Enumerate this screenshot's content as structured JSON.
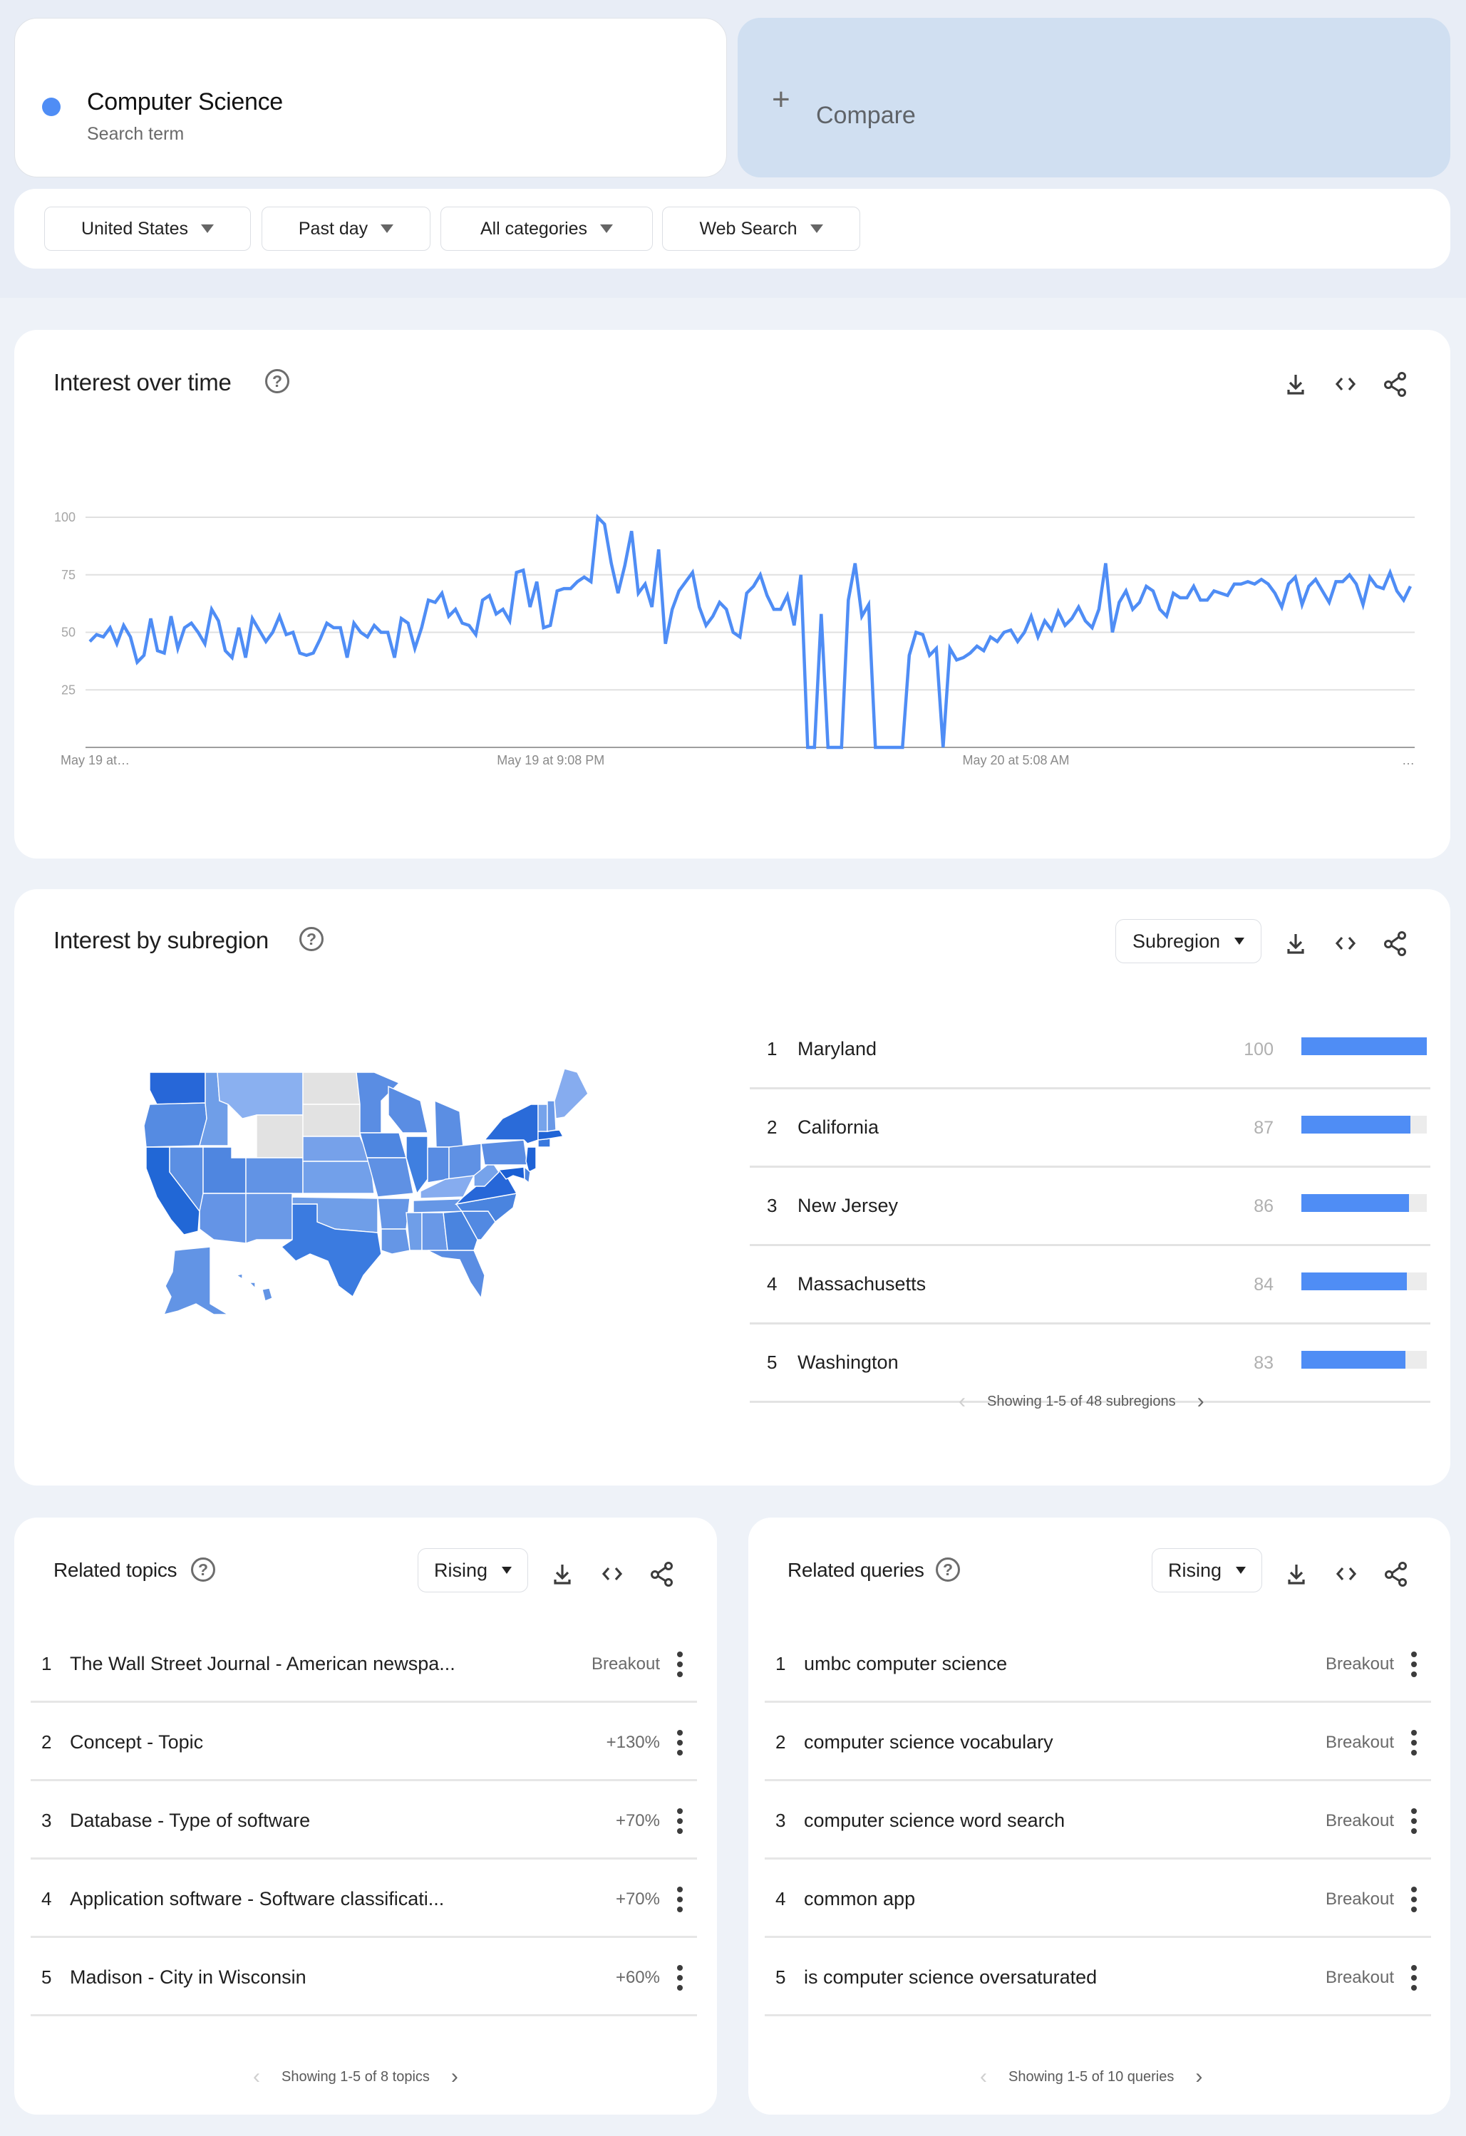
{
  "search_term": {
    "name": "Computer Science",
    "type_label": "Search term",
    "color": "#4f8df5"
  },
  "compare": {
    "label": "Compare",
    "icon": "plus-icon"
  },
  "filters": [
    {
      "label": "United States"
    },
    {
      "label": "Past day"
    },
    {
      "label": "All categories"
    },
    {
      "label": "Web Search"
    }
  ],
  "actions": {
    "download": "download-icon",
    "embed": "code-icon",
    "share": "share-icon",
    "help": "?"
  },
  "interest_over_time": {
    "title": "Interest over time",
    "help": "?"
  },
  "chart_data": {
    "type": "line",
    "title": "Interest over time",
    "xlabel": "",
    "ylabel": "",
    "ylim": [
      0,
      100
    ],
    "yticks": [
      25,
      50,
      75,
      100
    ],
    "grid": true,
    "x_tick_labels": [
      "May 19 at…",
      "May 19 at 9:08 PM",
      "May 20 at 5:08 AM",
      "…"
    ],
    "x_tick_positions_fraction": [
      0.0,
      0.35,
      0.7,
      1.0
    ],
    "series": [
      {
        "name": "Computer Science",
        "color": "#4f8df5",
        "values": [
          46,
          49,
          48,
          52,
          45,
          53,
          48,
          37,
          40,
          56,
          42,
          41,
          57,
          43,
          52,
          54,
          50,
          45,
          60,
          55,
          42,
          39,
          52,
          39,
          56,
          51,
          46,
          50,
          57,
          49,
          50,
          41,
          40,
          41,
          47,
          54,
          52,
          52,
          39,
          54,
          50,
          48,
          53,
          50,
          50,
          39,
          56,
          54,
          43,
          52,
          64,
          63,
          67,
          57,
          60,
          54,
          53,
          49,
          64,
          66,
          58,
          60,
          55,
          76,
          77,
          61,
          72,
          52,
          53,
          68,
          69,
          69,
          72,
          74,
          72,
          100,
          97,
          80,
          67,
          79,
          94,
          67,
          71,
          61,
          86,
          45,
          60,
          68,
          72,
          76,
          61,
          53,
          57,
          63,
          60,
          50,
          48,
          67,
          70,
          75,
          66,
          60,
          60,
          66,
          53,
          75,
          0,
          0,
          58,
          0,
          0,
          0,
          64,
          80,
          57,
          62,
          0,
          0,
          0,
          0,
          0,
          40,
          50,
          49,
          40,
          43,
          0,
          43,
          38,
          39,
          41,
          44,
          42,
          48,
          46,
          50,
          51,
          46,
          50,
          57,
          48,
          55,
          51,
          59,
          53,
          56,
          61,
          55,
          52,
          60,
          80,
          50,
          63,
          68,
          60,
          63,
          70,
          68,
          60,
          57,
          67,
          65,
          65,
          70,
          64,
          64,
          68,
          67,
          66,
          71,
          71,
          72,
          71,
          73,
          71,
          67,
          61,
          71,
          74,
          62,
          70,
          73,
          68,
          63,
          72,
          72,
          75,
          71,
          62,
          74,
          70,
          69,
          76,
          68,
          64,
          70
        ]
      }
    ]
  },
  "interest_by_subregion": {
    "title": "Interest by subregion",
    "help": "?",
    "select_label": "Subregion",
    "rows": [
      {
        "rank": "1",
        "name": "Maryland",
        "value": 100
      },
      {
        "rank": "2",
        "name": "California",
        "value": 87
      },
      {
        "rank": "3",
        "name": "New Jersey",
        "value": 86
      },
      {
        "rank": "4",
        "name": "Massachusetts",
        "value": 84
      },
      {
        "rank": "5",
        "name": "Washington",
        "value": 83
      }
    ],
    "pager_text": "Showing 1-5 of 48 subregions",
    "bar_color": "#4f8df5",
    "map": {
      "no_data_color": "#e2e2e2",
      "high_color": "#1a5fd4",
      "low_color": "#8ab0f0"
    }
  },
  "related_topics": {
    "title": "Related topics",
    "help": "?",
    "select_label": "Rising",
    "rows": [
      {
        "rank": "1",
        "label": "The Wall Street Journal - American newspa...",
        "value": "Breakout"
      },
      {
        "rank": "2",
        "label": "Concept - Topic",
        "value": "+130%"
      },
      {
        "rank": "3",
        "label": "Database - Type of software",
        "value": "+70%"
      },
      {
        "rank": "4",
        "label": "Application software - Software classificati...",
        "value": "+70%"
      },
      {
        "rank": "5",
        "label": "Madison - City in Wisconsin",
        "value": "+60%"
      }
    ],
    "pager_text": "Showing 1-5 of 8 topics"
  },
  "related_queries": {
    "title": "Related queries",
    "help": "?",
    "select_label": "Rising",
    "rows": [
      {
        "rank": "1",
        "label": "umbc computer science",
        "value": "Breakout"
      },
      {
        "rank": "2",
        "label": "computer science vocabulary",
        "value": "Breakout"
      },
      {
        "rank": "3",
        "label": "computer science word search",
        "value": "Breakout"
      },
      {
        "rank": "4",
        "label": "common app",
        "value": "Breakout"
      },
      {
        "rank": "5",
        "label": "is computer science oversaturated",
        "value": "Breakout"
      }
    ],
    "pager_text": "Showing 1-5 of 10 queries"
  }
}
